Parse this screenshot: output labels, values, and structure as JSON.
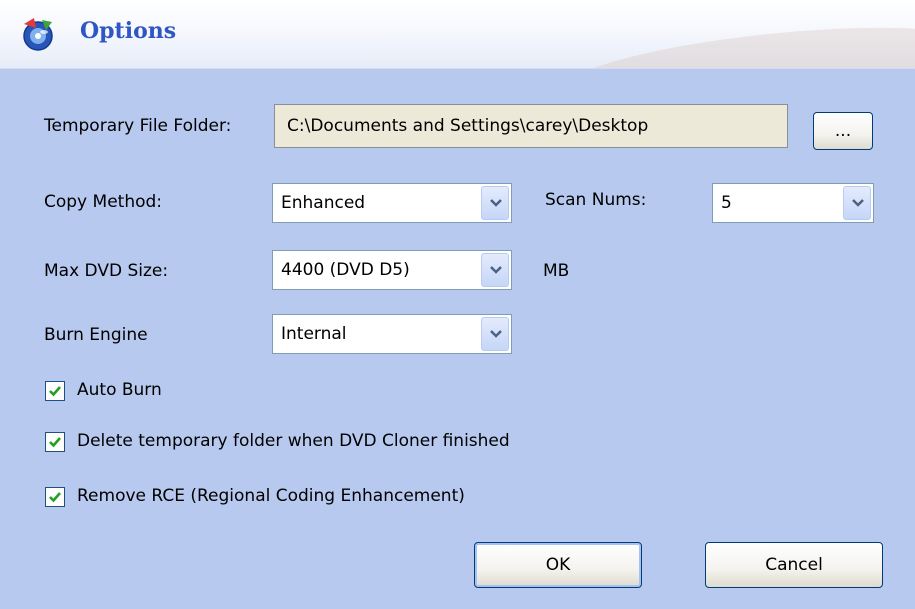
{
  "window": {
    "title": "Options",
    "icon": "dvd-cloner-app-icon"
  },
  "temp_folder": {
    "label": "Temporary File Folder:",
    "value": "C:\\Documents and Settings\\carey\\Desktop",
    "browse_label": "..."
  },
  "copy_method": {
    "label": "Copy Method:",
    "value": "Enhanced"
  },
  "scan_nums": {
    "label": "Scan Nums:",
    "value": "5"
  },
  "max_dvd_size": {
    "label": "Max DVD Size:",
    "value": "4400 (DVD D5)",
    "unit": "MB"
  },
  "burn_engine": {
    "label": "Burn Engine",
    "value": "Internal"
  },
  "options": [
    {
      "label": "Auto Burn",
      "checked": true
    },
    {
      "label": "Delete temporary folder when DVD Cloner finished",
      "checked": true
    },
    {
      "label": "Remove RCE (Regional Coding Enhancement)",
      "checked": true
    }
  ],
  "buttons": {
    "ok": "OK",
    "cancel": "Cancel"
  },
  "colors": {
    "dialog_bg": "#b7c9ee",
    "title_text": "#2f56c4",
    "field_readonly_bg": "#ece9d8",
    "checkmark": "#21a121"
  }
}
